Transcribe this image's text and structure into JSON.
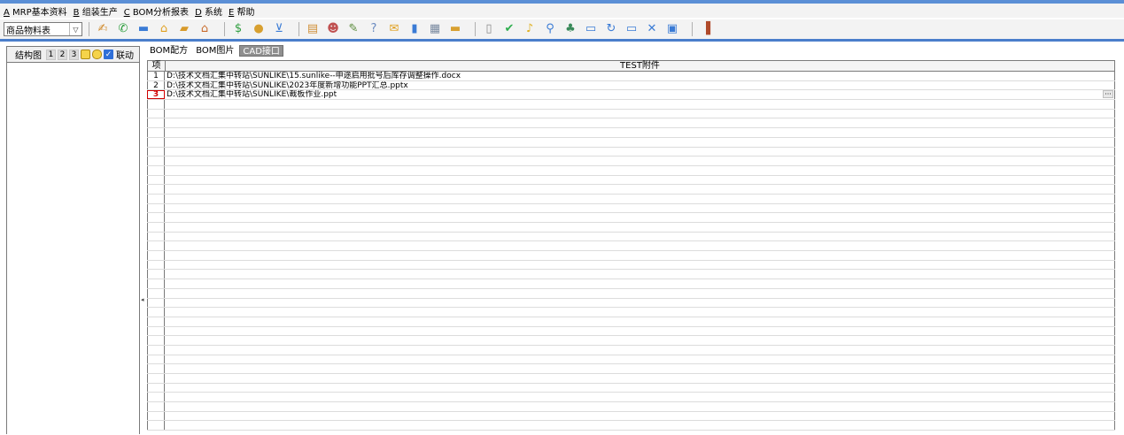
{
  "menu": [
    {
      "key": "A",
      "label": " MRP基本资料"
    },
    {
      "key": "B",
      "label": " 组装生产"
    },
    {
      "key": "C",
      "label": " BOM分析报表"
    },
    {
      "key": "D",
      "label": " 系统"
    },
    {
      "key": "E",
      "label": " 帮助"
    }
  ],
  "toolbar": {
    "combo_value": "商品物料表",
    "icons": [
      {
        "name": "person-tool-icon",
        "glyph": "✍",
        "color": "#d08a2a"
      },
      {
        "name": "phone-icon",
        "glyph": "✆",
        "color": "#2e9e3e"
      },
      {
        "name": "monitor-icon",
        "glyph": "▬",
        "color": "#3a7bd5"
      },
      {
        "name": "lock-icon",
        "glyph": "⌂",
        "color": "#e0a020"
      },
      {
        "name": "briefcase-icon",
        "glyph": "▰",
        "color": "#d89a2a"
      },
      {
        "name": "house-icon",
        "glyph": "⌂",
        "color": "#c86a2a"
      },
      {
        "name": "dollar-icon",
        "glyph": "$",
        "color": "#2e9e3e"
      },
      {
        "name": "money-bag-icon",
        "glyph": "●",
        "color": "#d8a030"
      },
      {
        "name": "cart-icon",
        "glyph": "⊻",
        "color": "#3a7bd5"
      },
      {
        "name": "clipboard-icon",
        "glyph": "▤",
        "color": "#d0903a"
      },
      {
        "name": "users-icon",
        "glyph": "☻",
        "color": "#c05050"
      },
      {
        "name": "tools-icon",
        "glyph": "✎",
        "color": "#5a8a3a"
      },
      {
        "name": "help-doc-icon",
        "glyph": "?",
        "color": "#6a8ac0"
      },
      {
        "name": "mail-icon",
        "glyph": "✉",
        "color": "#e0a020"
      },
      {
        "name": "book-icon",
        "glyph": "▮",
        "color": "#3a7bd5"
      },
      {
        "name": "calculator-icon",
        "glyph": "▦",
        "color": "#7a8aa0"
      },
      {
        "name": "folder-icon",
        "glyph": "▬",
        "color": "#d8a030"
      },
      {
        "name": "document-icon",
        "glyph": "▯",
        "color": "#8a8a8a"
      },
      {
        "name": "check-circle-icon",
        "glyph": "✔",
        "color": "#2eae4e"
      },
      {
        "name": "bell-icon",
        "glyph": "♪",
        "color": "#e0b020"
      },
      {
        "name": "search-icon",
        "glyph": "⚲",
        "color": "#3a7bd5"
      },
      {
        "name": "org-chart-icon",
        "glyph": "♣",
        "color": "#3a8a5a"
      },
      {
        "name": "computer-icon",
        "glyph": "▭",
        "color": "#3a7bd5"
      },
      {
        "name": "refresh-icon",
        "glyph": "↻",
        "color": "#3a7bd5"
      },
      {
        "name": "window-icon",
        "glyph": "▭",
        "color": "#3a7bd5"
      },
      {
        "name": "close-box-icon",
        "glyph": "✕",
        "color": "#3a7bd5"
      },
      {
        "name": "minimize-box-icon",
        "glyph": "▣",
        "color": "#3a7bd5"
      },
      {
        "name": "exit-door-icon",
        "glyph": "▐",
        "color": "#b04a2a"
      }
    ]
  },
  "left_panel": {
    "title": "结构图",
    "levels": [
      "1",
      "2",
      "3"
    ],
    "link_label": "联动",
    "link_checked": true
  },
  "tabs": [
    {
      "label": "BOM配方",
      "active": false
    },
    {
      "label": "BOM图片",
      "active": false
    },
    {
      "label": "CAD接口",
      "active": true
    }
  ],
  "grid": {
    "col_no": "项",
    "col_file": "TEST附件",
    "rows": [
      {
        "no": "1",
        "file": "D:\\技术文档汇集中转站\\SUNLIKE\\15.sunlike--申途启用批号后库存调整操作.docx"
      },
      {
        "no": "2",
        "file": "D:\\技术文档汇集中转站\\SUNLIKE\\2023年度新增功能PPT汇总.pptx"
      },
      {
        "no": "3",
        "file": "D:\\技术文档汇集中转站\\SUNLIKE\\裁板作业.ppt",
        "current": true,
        "ellipsis": "···"
      }
    ],
    "empty_rows": 35
  }
}
